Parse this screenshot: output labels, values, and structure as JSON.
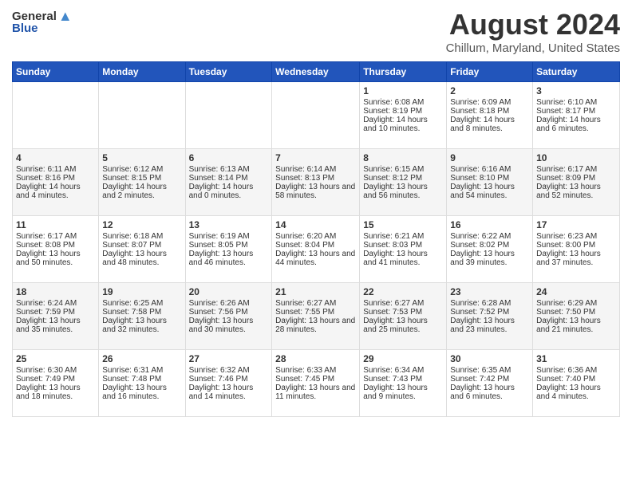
{
  "header": {
    "logo_general": "General",
    "logo_blue": "Blue",
    "month_year": "August 2024",
    "location": "Chillum, Maryland, United States"
  },
  "days_of_week": [
    "Sunday",
    "Monday",
    "Tuesday",
    "Wednesday",
    "Thursday",
    "Friday",
    "Saturday"
  ],
  "weeks": [
    [
      {
        "day": "",
        "content": ""
      },
      {
        "day": "",
        "content": ""
      },
      {
        "day": "",
        "content": ""
      },
      {
        "day": "",
        "content": ""
      },
      {
        "day": "1",
        "content": "Sunrise: 6:08 AM\nSunset: 8:19 PM\nDaylight: 14 hours and 10 minutes."
      },
      {
        "day": "2",
        "content": "Sunrise: 6:09 AM\nSunset: 8:18 PM\nDaylight: 14 hours and 8 minutes."
      },
      {
        "day": "3",
        "content": "Sunrise: 6:10 AM\nSunset: 8:17 PM\nDaylight: 14 hours and 6 minutes."
      }
    ],
    [
      {
        "day": "4",
        "content": "Sunrise: 6:11 AM\nSunset: 8:16 PM\nDaylight: 14 hours and 4 minutes."
      },
      {
        "day": "5",
        "content": "Sunrise: 6:12 AM\nSunset: 8:15 PM\nDaylight: 14 hours and 2 minutes."
      },
      {
        "day": "6",
        "content": "Sunrise: 6:13 AM\nSunset: 8:14 PM\nDaylight: 14 hours and 0 minutes."
      },
      {
        "day": "7",
        "content": "Sunrise: 6:14 AM\nSunset: 8:13 PM\nDaylight: 13 hours and 58 minutes."
      },
      {
        "day": "8",
        "content": "Sunrise: 6:15 AM\nSunset: 8:12 PM\nDaylight: 13 hours and 56 minutes."
      },
      {
        "day": "9",
        "content": "Sunrise: 6:16 AM\nSunset: 8:10 PM\nDaylight: 13 hours and 54 minutes."
      },
      {
        "day": "10",
        "content": "Sunrise: 6:17 AM\nSunset: 8:09 PM\nDaylight: 13 hours and 52 minutes."
      }
    ],
    [
      {
        "day": "11",
        "content": "Sunrise: 6:17 AM\nSunset: 8:08 PM\nDaylight: 13 hours and 50 minutes."
      },
      {
        "day": "12",
        "content": "Sunrise: 6:18 AM\nSunset: 8:07 PM\nDaylight: 13 hours and 48 minutes."
      },
      {
        "day": "13",
        "content": "Sunrise: 6:19 AM\nSunset: 8:05 PM\nDaylight: 13 hours and 46 minutes."
      },
      {
        "day": "14",
        "content": "Sunrise: 6:20 AM\nSunset: 8:04 PM\nDaylight: 13 hours and 44 minutes."
      },
      {
        "day": "15",
        "content": "Sunrise: 6:21 AM\nSunset: 8:03 PM\nDaylight: 13 hours and 41 minutes."
      },
      {
        "day": "16",
        "content": "Sunrise: 6:22 AM\nSunset: 8:02 PM\nDaylight: 13 hours and 39 minutes."
      },
      {
        "day": "17",
        "content": "Sunrise: 6:23 AM\nSunset: 8:00 PM\nDaylight: 13 hours and 37 minutes."
      }
    ],
    [
      {
        "day": "18",
        "content": "Sunrise: 6:24 AM\nSunset: 7:59 PM\nDaylight: 13 hours and 35 minutes."
      },
      {
        "day": "19",
        "content": "Sunrise: 6:25 AM\nSunset: 7:58 PM\nDaylight: 13 hours and 32 minutes."
      },
      {
        "day": "20",
        "content": "Sunrise: 6:26 AM\nSunset: 7:56 PM\nDaylight: 13 hours and 30 minutes."
      },
      {
        "day": "21",
        "content": "Sunrise: 6:27 AM\nSunset: 7:55 PM\nDaylight: 13 hours and 28 minutes."
      },
      {
        "day": "22",
        "content": "Sunrise: 6:27 AM\nSunset: 7:53 PM\nDaylight: 13 hours and 25 minutes."
      },
      {
        "day": "23",
        "content": "Sunrise: 6:28 AM\nSunset: 7:52 PM\nDaylight: 13 hours and 23 minutes."
      },
      {
        "day": "24",
        "content": "Sunrise: 6:29 AM\nSunset: 7:50 PM\nDaylight: 13 hours and 21 minutes."
      }
    ],
    [
      {
        "day": "25",
        "content": "Sunrise: 6:30 AM\nSunset: 7:49 PM\nDaylight: 13 hours and 18 minutes."
      },
      {
        "day": "26",
        "content": "Sunrise: 6:31 AM\nSunset: 7:48 PM\nDaylight: 13 hours and 16 minutes."
      },
      {
        "day": "27",
        "content": "Sunrise: 6:32 AM\nSunset: 7:46 PM\nDaylight: 13 hours and 14 minutes."
      },
      {
        "day": "28",
        "content": "Sunrise: 6:33 AM\nSunset: 7:45 PM\nDaylight: 13 hours and 11 minutes."
      },
      {
        "day": "29",
        "content": "Sunrise: 6:34 AM\nSunset: 7:43 PM\nDaylight: 13 hours and 9 minutes."
      },
      {
        "day": "30",
        "content": "Sunrise: 6:35 AM\nSunset: 7:42 PM\nDaylight: 13 hours and 6 minutes."
      },
      {
        "day": "31",
        "content": "Sunrise: 6:36 AM\nSunset: 7:40 PM\nDaylight: 13 hours and 4 minutes."
      }
    ]
  ]
}
